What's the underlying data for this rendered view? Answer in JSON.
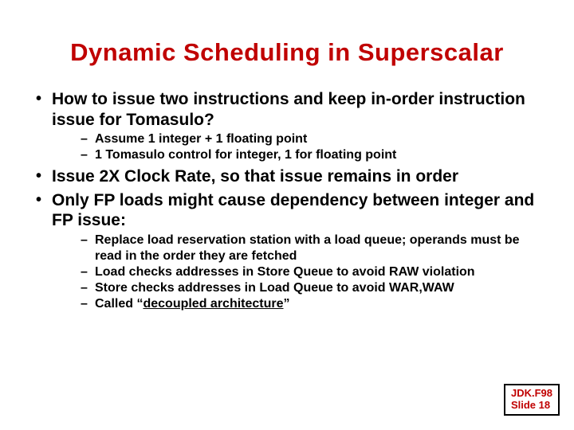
{
  "title": "Dynamic Scheduling in Superscalar",
  "b1": {
    "i0": "How to issue two instructions and keep in-order instruction issue for Tomasulo?",
    "i1": "Issue 2X Clock Rate, so that issue remains in order",
    "i2": "Only FP loads might cause dependency between integer and FP issue:"
  },
  "b2a": {
    "i0": "Assume 1 integer + 1 floating point",
    "i1": "1 Tomasulo control for integer, 1 for floating point"
  },
  "b2b": {
    "i0": "Replace load reservation station with a load queue; operands must be read in the order they are fetched",
    "i1": "Load checks addresses in Store Queue to avoid RAW violation",
    "i2": "Store checks addresses in Load Queue to avoid WAR,WAW",
    "i3_pre": "Called “",
    "i3_u": "decoupled architecture",
    "i3_post": "”"
  },
  "footer": {
    "line1": "JDK.F98",
    "line2": "Slide 18"
  }
}
